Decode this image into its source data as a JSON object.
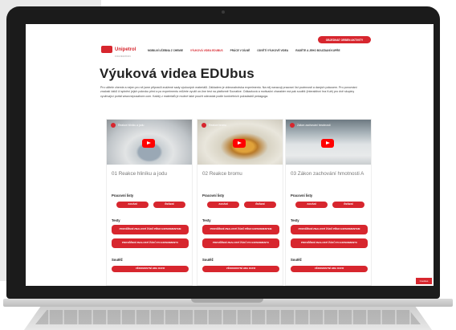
{
  "header": {
    "logo_text": "Unipetrol",
    "logo_sub": "FOUNDATION",
    "cta_label": "OBJEDNAT ORBEN AKTIVITY",
    "nav": [
      "MOBILNÍ UČEBNA Z CHEMIE",
      "VÝUKOVÁ VIDEA EDUBUS",
      "PRÁCE V DÍLNĚ",
      "ODVĚTÍ VÝUKOVÉ VIDEA",
      "RADĚTE A JEHO BOUZDANÍ KUPŘE"
    ]
  },
  "page": {
    "title": "Výuková videa EDUbus",
    "intro": "Pro učitele chemie a nejen pro ně jsme připravili zvážené sady výukových materiálů. Základem je videonahrávka experimentu. Na něj navazují pracovní list povinnosti a daných pokusem. Pro porovnání znalostí žáků či splnění jejich pokroku před a po experimentu můžete využít on-line test na platformě Socrative. Odkazková a motivační charakter má pak soutěž (interaktivní hra Kufr) pro dvě skupiny využívající portál www.nepusahore.com. Každý z materiálů je možné také použít odevzdat podle konkrétních požadavků pedagoga."
  },
  "cards": [
    {
      "thumb_label": "Reakce hliníku a jodu",
      "title": "01 Reakce hliníku a jodu",
      "worksheets": "Pracovní listy",
      "btn_assign": "ZADÁNÍ",
      "btn_solution": "ŘEŠENÍ",
      "tests": "Testy",
      "btn_test_before": "PROVĚŘENÍ ZNALOSTÍ ŽÁKŮ PŘED EXPERIMENTEM",
      "btn_test_after": "PROVĚŘENÍ ZNALOSTÍ ŽÁKŮ PO EXPERIMENTU",
      "competition": "Soutěž",
      "btn_game": "VĚDOMOSTNÍ HRA KUFR"
    },
    {
      "thumb_label": "Reakce bromu",
      "title": "02 Reakce bromu",
      "worksheets": "Pracovní listy",
      "btn_assign": "ZADÁNÍ",
      "btn_solution": "ŘEŠENÍ",
      "tests": "Testy",
      "btn_test_before": "PROVĚŘENÍ ZNALOSTÍ ŽÁKŮ PŘED EXPERIMENTEM",
      "btn_test_after": "PROVĚŘENÍ ZNALOSTÍ ŽÁKŮ PO EXPERIMENTU",
      "competition": "Soutěž",
      "btn_game": "VĚDOMOSTNÍ HRA KUFR"
    },
    {
      "thumb_label": "Zákon zachování hmotnosti",
      "title": "03 Zákon zachování hmotnosti A",
      "worksheets": "Pracovní listy",
      "btn_assign": "ZADÁNÍ",
      "btn_solution": "ŘEŠENÍ",
      "tests": "Testy",
      "btn_test_before": "PROVĚŘENÍ ZNALOSTÍ ŽÁKŮ PŘED EXPERIMENTEM",
      "btn_test_after": "PROVĚŘENÍ ZNALOSTÍ ŽÁKŮ PO EXPERIMENTU",
      "competition": "Soutěž",
      "btn_game": "VĚDOMOSTNÍ HRA KUFR"
    }
  ],
  "cookie_label": "Cookies",
  "colors": {
    "brand": "#d7262e",
    "frame": "#1b1b1b"
  },
  "icons": [
    "play-icon",
    "logo-icon"
  ]
}
